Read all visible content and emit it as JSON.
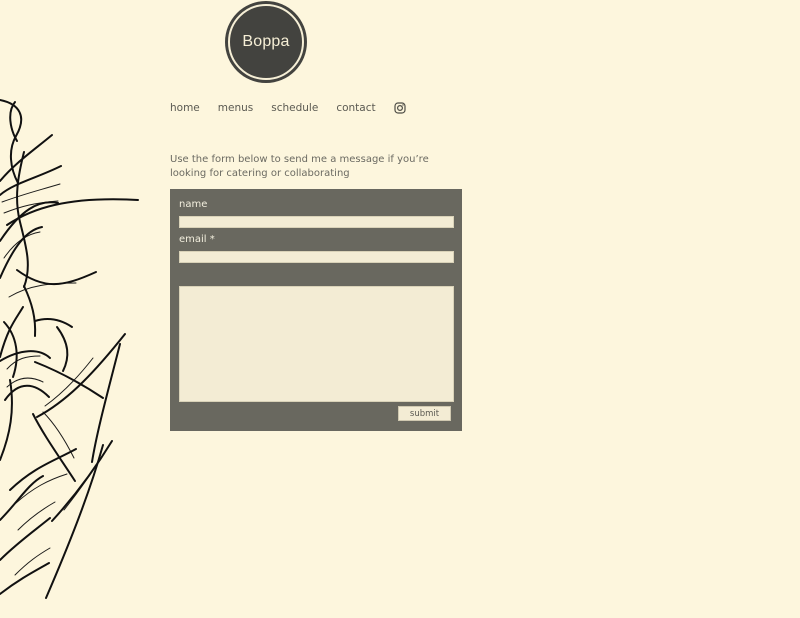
{
  "brand": {
    "logo_text": "Boppa"
  },
  "nav": {
    "items": [
      "home",
      "menus",
      "schedule",
      "contact"
    ],
    "icon": "instagram-icon"
  },
  "intro": {
    "text": "Use the form below to send me a message if you’re looking for catering or collaborating"
  },
  "form": {
    "name_label": "name",
    "email_label": "email *",
    "name_value": "",
    "email_value": "",
    "message_value": "",
    "submit_label": "submit"
  },
  "colors": {
    "page_bg": "#fdf6dd",
    "form_bg": "#69685f",
    "logo_bg": "#43433f",
    "field_bg": "#f3ecd4"
  }
}
